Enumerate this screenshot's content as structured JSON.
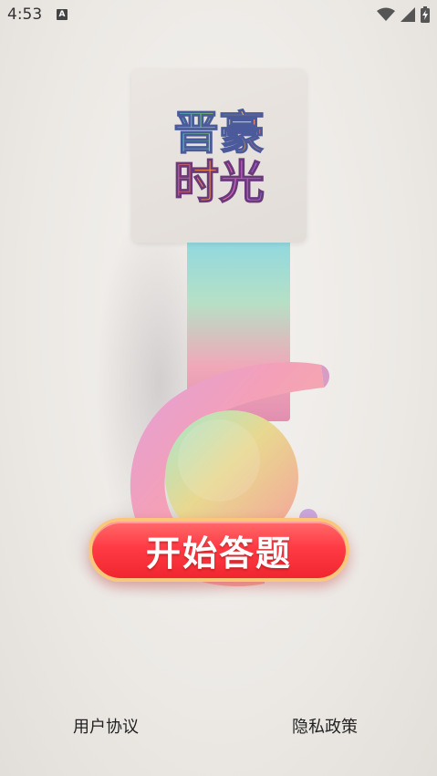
{
  "status_bar": {
    "time": "4:53",
    "notification_icon_letter": "A",
    "icons": [
      "wifi-icon",
      "signal-icon",
      "battery-charging-icon"
    ]
  },
  "logo": {
    "line1": "晋豪",
    "line2": "时光"
  },
  "main": {
    "start_button_label": "开始答题"
  },
  "footer": {
    "user_agreement": "用户协议",
    "privacy_policy": "隐私政策"
  },
  "colors": {
    "button_red": "#ff3b45",
    "button_border": "#f9c77a",
    "background": "#ece9e5"
  }
}
